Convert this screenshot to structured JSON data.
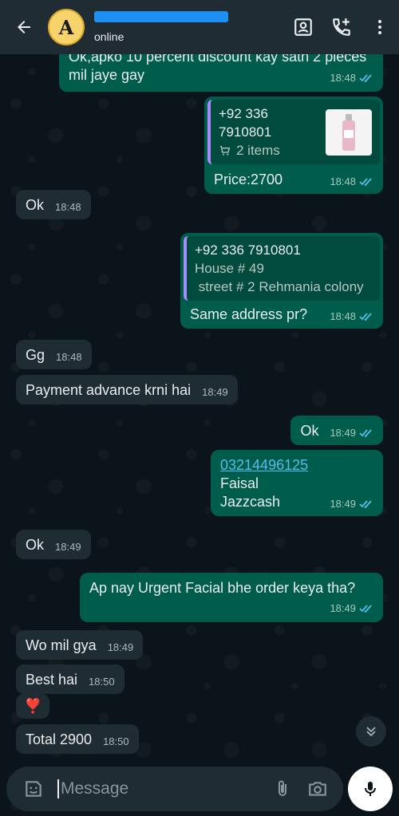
{
  "header": {
    "avatar_letter": "A",
    "status": "online"
  },
  "messages": [
    {
      "id": "m1",
      "dir": "out",
      "text": "Ok,apko 10 percent discount kay sath 2 pieces mil jaye gay",
      "time": "18:48"
    },
    {
      "id": "m2",
      "dir": "out",
      "quote_phone": "+92 336 7910801",
      "quote_items": "2 items",
      "text": "Price:2700",
      "time": "18:48"
    },
    {
      "id": "m3",
      "dir": "in",
      "text": "Ok",
      "time": "18:48"
    },
    {
      "id": "m4",
      "dir": "out",
      "quote_phone": "+92 336 7910801",
      "quote_line1": "House # 49",
      "quote_line2": " street # 2 Rehmania colony",
      "text": "Same address pr?",
      "time": "18:48"
    },
    {
      "id": "m5",
      "dir": "in",
      "text": "Gg",
      "time": "18:48"
    },
    {
      "id": "m6",
      "dir": "in",
      "text": "Payment advance krni hai",
      "time": "18:49"
    },
    {
      "id": "m7",
      "dir": "out",
      "text": "Ok",
      "time": "18:49"
    },
    {
      "id": "m8",
      "dir": "out",
      "link": "03214496125",
      "line2": "Faisal",
      "line3": "Jazzcash",
      "time": "18:49"
    },
    {
      "id": "m9",
      "dir": "in",
      "text": "Ok",
      "time": "18:49"
    },
    {
      "id": "m10",
      "dir": "out",
      "text": "Ap nay Urgent Facial bhe order keya tha?",
      "time": "18:49"
    },
    {
      "id": "m11",
      "dir": "in",
      "text": "Wo mil gya",
      "time": "18:49"
    },
    {
      "id": "m12",
      "dir": "in",
      "text": "Best hai",
      "time": "18:50"
    },
    {
      "id": "m13",
      "dir": "in",
      "text": "❣️"
    },
    {
      "id": "m14",
      "dir": "in",
      "text": "Total 2900",
      "time": "18:50"
    }
  ],
  "input": {
    "placeholder": "Message"
  },
  "icons": [
    "back-arrow-icon",
    "contact-card-icon",
    "add-call-icon",
    "more-vert-icon",
    "cart-icon",
    "double-check-icon",
    "chevron-down-double-icon",
    "sticker-icon",
    "attach-icon",
    "camera-icon",
    "mic-icon"
  ],
  "colors": {
    "header_bg": "#1f2c34",
    "incoming": "#1f2c34",
    "outgoing": "#005c4b",
    "link": "#53bdeb",
    "tick": "#53bdeb"
  }
}
